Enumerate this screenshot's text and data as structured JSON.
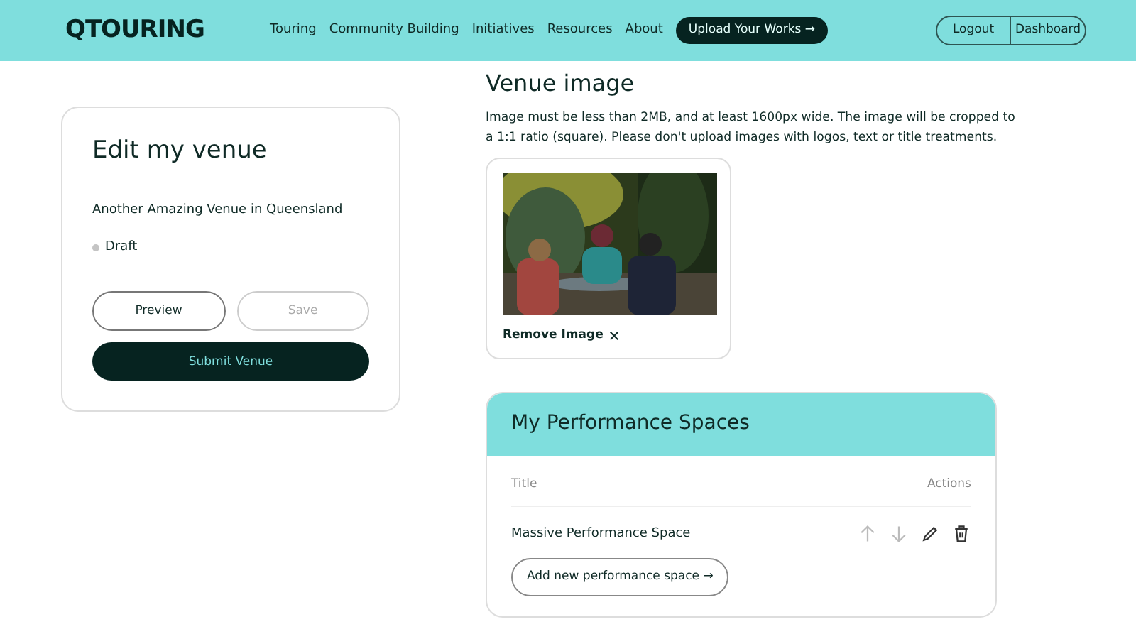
{
  "navbar": {
    "logo": "QTOURING",
    "links": [
      "Touring",
      "Community Building",
      "Initiatives",
      "Resources",
      "About"
    ],
    "upload_button": "Upload Your Works →",
    "account_buttons": [
      "Logout",
      "Dashboard"
    ]
  },
  "venue_card": {
    "title": "Edit my venue",
    "venue_name": "Another Amazing Venue in Queensland",
    "status": {
      "label": "Draft",
      "color": "#c4c4c4"
    },
    "buttons": [
      {
        "label": "Preview",
        "disabled": false
      },
      {
        "label": "Save",
        "disabled": true
      }
    ],
    "submit": "Submit Venue"
  },
  "venue_image": {
    "heading": "Venue image",
    "help": "Image must be less than 2MB, and at least 1600px wide. The image will be cropped to a 1:1 ratio (square). Please don't upload images with logos, text or title treatments.",
    "remove": "Remove Image"
  },
  "performance_spaces": {
    "title": "My Performance Spaces",
    "columns": [
      "Title",
      "Actions"
    ],
    "rows": [
      {
        "title": "Massive Performance Space",
        "move_up_disabled": true,
        "move_down_disabled": true
      }
    ],
    "add_button": "Add new performance space →"
  }
}
